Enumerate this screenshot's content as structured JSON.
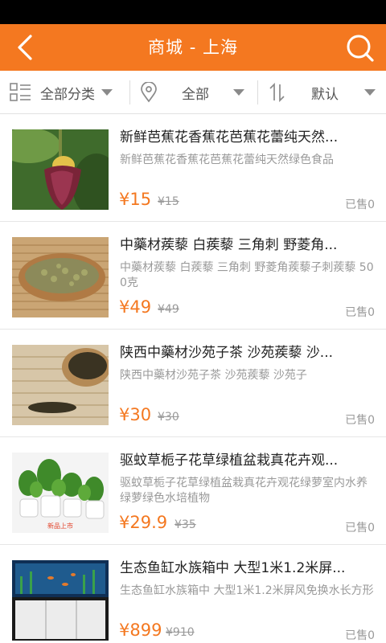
{
  "header": {
    "title": "商城 - 上海",
    "back_icon": "back-arrow-icon",
    "search_icon": "search-icon",
    "color": "#f47820"
  },
  "filters": {
    "category": {
      "label": "全部分类",
      "icon": "list-grid-icon"
    },
    "location": {
      "label": "全部",
      "icon": "location-pin-icon"
    },
    "sort": {
      "label": "默认",
      "icon": "sort-arrows-icon"
    }
  },
  "products": [
    {
      "name": "新鲜芭蕉花香蕉花芭蕉花蕾纯天然...",
      "desc": "新鲜芭蕉花香蕉花芭蕉花蕾纯天然绿色食品",
      "price": "¥15",
      "old_price": "¥15",
      "sold": "已售0",
      "image": "banana-flower-image"
    },
    {
      "name": "中藥材蒺藜 白蒺藜 三角刺 野菱角...",
      "desc": "中藥材蒺藜 白蒺藜 三角刺 野菱角蒺藜子刺蒺藜 500克",
      "price": "¥49",
      "old_price": "¥49",
      "sold": "已售0",
      "image": "herbal-seeds-image"
    },
    {
      "name": "陕西中藥材沙苑子茶 沙苑蒺藜 沙...",
      "desc": "陕西中藥材沙苑子茶 沙苑蒺藜 沙苑子",
      "price": "¥30",
      "old_price": "¥30",
      "sold": "已售0",
      "image": "dark-seeds-image"
    },
    {
      "name": "驱蚊草栀子花草绿植盆栽真花卉观...",
      "desc": "驱蚊草栀子花草绿植盆栽真花卉观花绿萝室内水养绿萝绿色水培植物",
      "price": "¥29.9",
      "old_price": "¥35",
      "sold": "已售0",
      "image": "potted-plants-image",
      "image_caption": "新品上市"
    },
    {
      "name": "生态鱼缸水族箱中 大型1米1.2米屏...",
      "desc": "生态鱼缸水族箱中 大型1米1.2米屏风免换水长方形",
      "price": "¥899",
      "old_price": "¥910",
      "sold": "已售0",
      "image": "aquarium-cabinet-image"
    }
  ]
}
